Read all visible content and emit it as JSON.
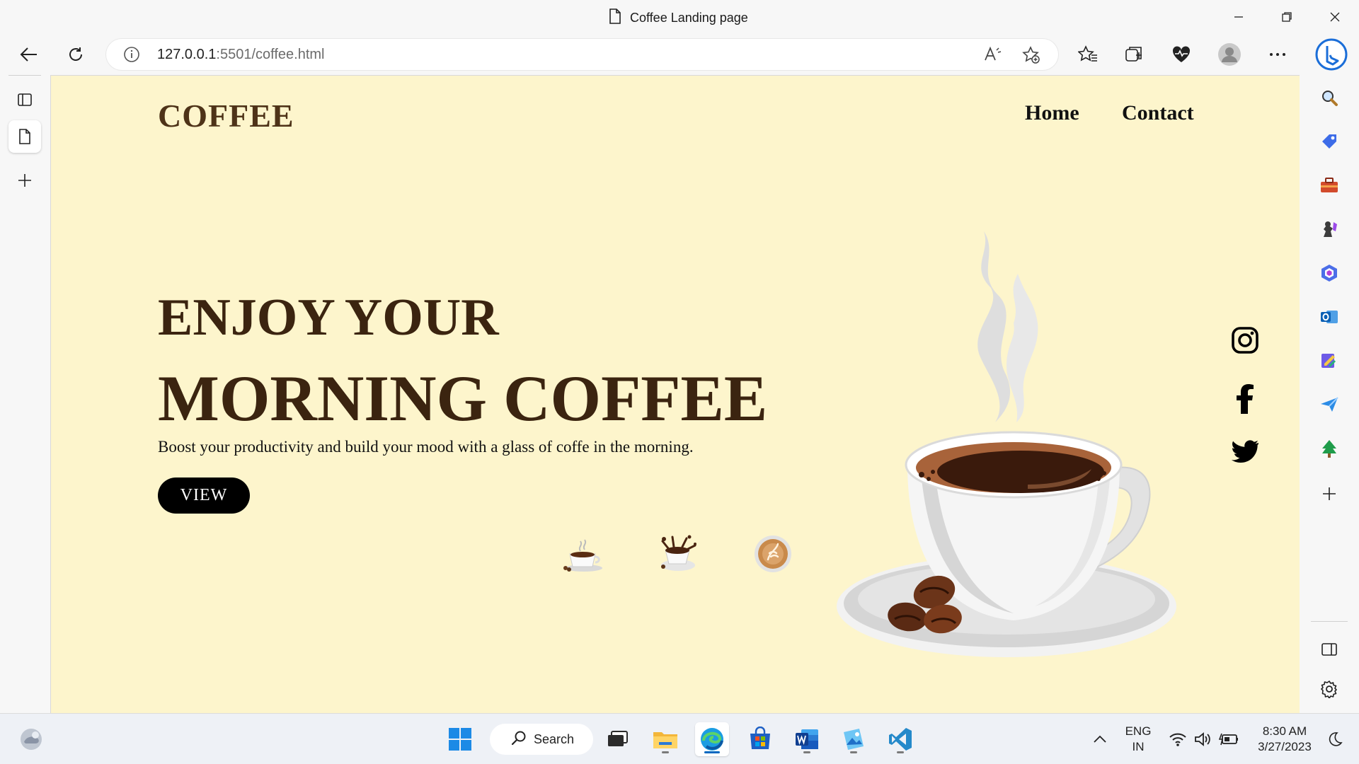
{
  "window": {
    "title": "Coffee Landing page"
  },
  "browser": {
    "url_host": "127.0.0.1",
    "url_rest": ":5501/coffee.html",
    "icons": [
      "back-icon",
      "refresh-icon",
      "info-icon",
      "read-aloud-icon",
      "add-favorite-icon",
      "favorites-icon",
      "collections-icon",
      "browser-essentials-icon",
      "profile-icon",
      "more-icon",
      "bing-icon"
    ]
  },
  "sidebar_left": {
    "icons": [
      "tab-actions-icon",
      "page-icon",
      "new-tab-icon"
    ]
  },
  "sidebar_right": {
    "icons": [
      "search-icon",
      "shopping-icon",
      "tools-icon",
      "games-icon",
      "microsoft365-icon",
      "outlook-icon",
      "designer-icon",
      "send-icon",
      "tree-icon",
      "add-icon",
      "split-screen-icon",
      "settings-icon"
    ]
  },
  "page": {
    "logo": "COFFEE",
    "nav": {
      "home": "Home",
      "contact": "Contact"
    },
    "headline_line1": "ENJOY YOUR",
    "headline_line2": "MORNING COFFEE",
    "subtitle": "Boost your productivity and build your mood with a glass of coffe in the morning.",
    "cta": "VIEW",
    "social": [
      "instagram-icon",
      "facebook-icon",
      "twitter-icon"
    ],
    "colors": {
      "background": "#fdf5cc",
      "heading": "#3b2410",
      "logo": "#4e3318",
      "button": "#000000"
    }
  },
  "taskbar": {
    "search_label": "Search",
    "lang_line1": "ENG",
    "lang_line2": "IN",
    "time": "8:30 AM",
    "date": "3/27/2023"
  }
}
